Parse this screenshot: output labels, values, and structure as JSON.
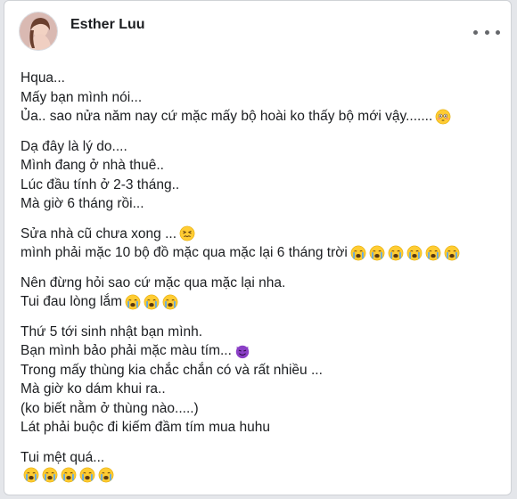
{
  "post": {
    "author": "Esther Luu",
    "paragraphs": [
      {
        "lines": [
          {
            "text": "Hqua...",
            "emoji": []
          },
          {
            "text": "Mấy bạn mình nói...",
            "emoji": []
          },
          {
            "text": "Ủa.. sao nửa năm nay cứ mặc mấy bộ hoài ko thấy bộ mới vậy.......",
            "emoji": [
              "flushed-face"
            ]
          }
        ]
      },
      {
        "lines": [
          {
            "text": "Dạ đây là lý do....",
            "emoji": []
          },
          {
            "text": "Mình đang ở nhà thuê..",
            "emoji": []
          },
          {
            "text": "Lúc đầu tính ở 2-3 tháng..",
            "emoji": []
          },
          {
            "text": "Mà giờ 6 tháng rồi...",
            "emoji": []
          }
        ]
      },
      {
        "lines": [
          {
            "text": "Sửa nhà cũ chưa xong ...",
            "emoji": [
              "persevering-face"
            ]
          },
          {
            "text": "mình phải mặc 10 bộ đồ mặc qua mặc lại 6 tháng trời",
            "emoji": [
              "crying-face",
              "crying-face",
              "crying-face",
              "crying-face",
              "crying-face",
              "crying-face"
            ]
          }
        ]
      },
      {
        "lines": [
          {
            "text": "Nên đừng hỏi sao cứ mặc qua mặc lại nha.",
            "emoji": []
          },
          {
            "text": "Tui đau lòng lắm",
            "emoji": [
              "crying-face",
              "crying-face",
              "crying-face"
            ]
          }
        ]
      },
      {
        "lines": [
          {
            "text": "Thứ 5 tới sinh nhật bạn mình.",
            "emoji": []
          },
          {
            "text": "Bạn mình bảo phải mặc màu tím...",
            "emoji": [
              "purple-devil"
            ]
          },
          {
            "text": "Trong mấy thùng kia chắc chắn có và rất nhiều ...",
            "emoji": []
          },
          {
            "text": "Mà giờ ko dám khui ra..",
            "emoji": []
          },
          {
            "text": "(ko biết nằm ở thùng nào.....)",
            "emoji": []
          },
          {
            "text": "Lát phải buộc đi kiếm đầm tím mua huhu",
            "emoji": []
          }
        ]
      },
      {
        "lines": [
          {
            "text": "Tui mệt quá...",
            "emoji": []
          },
          {
            "text": "",
            "emoji": [
              "crying-face",
              "crying-face",
              "crying-face",
              "crying-face",
              "crying-face"
            ]
          }
        ]
      }
    ]
  },
  "colors": {
    "text": "#1c1e21",
    "emoji_yellow": "#ffcc33",
    "tear_blue": "#5fa8e8",
    "devil_purple": "#8b3fc6"
  }
}
